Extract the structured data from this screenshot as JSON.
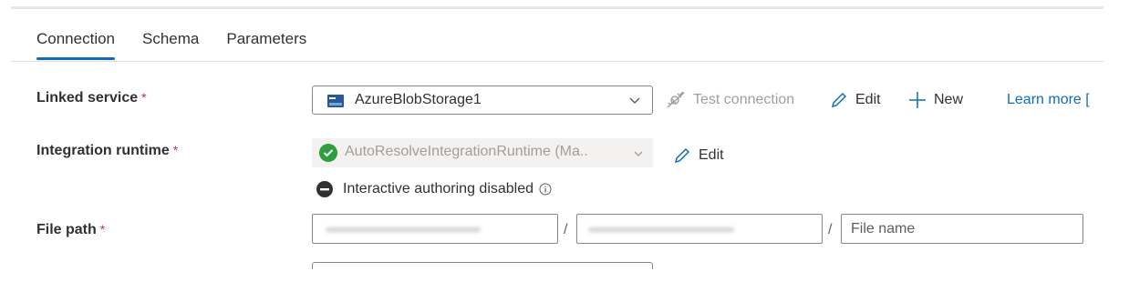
{
  "tabs": [
    {
      "label": "Connection",
      "active": true
    },
    {
      "label": "Schema",
      "active": false
    },
    {
      "label": "Parameters",
      "active": false
    }
  ],
  "form": {
    "required_marker": "*",
    "linked_service": {
      "label": "Linked service",
      "value": "AzureBlobStorage1",
      "test_connection": "Test connection",
      "edit": "Edit",
      "new": "New",
      "learn_more": "Learn more ["
    },
    "integration_runtime": {
      "label": "Integration runtime",
      "value": "AutoResolveIntegrationRuntime (Ma..",
      "edit": "Edit",
      "status_text": "Interactive authoring disabled"
    },
    "file_path": {
      "label": "File path",
      "separator": "/",
      "file_name_placeholder": "File name"
    }
  },
  "colors": {
    "accent": "#0f6cbd",
    "required": "#c4314b",
    "success": "#2e9e3f",
    "disabled_text": "#a19f9d"
  }
}
